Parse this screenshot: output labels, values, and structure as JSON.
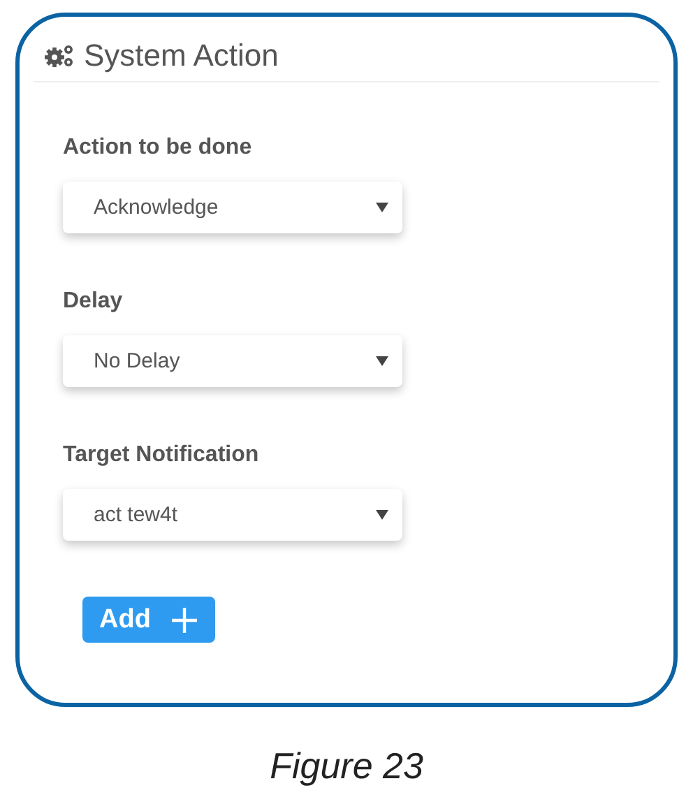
{
  "panel": {
    "title": "System Action"
  },
  "fields": [
    {
      "label": "Action to be done",
      "value": "Acknowledge"
    },
    {
      "label": "Delay",
      "value": "No Delay"
    },
    {
      "label": "Target Notification",
      "value": "act tew4t"
    }
  ],
  "add_button": {
    "label": "Add"
  },
  "caption": "Figure 23"
}
